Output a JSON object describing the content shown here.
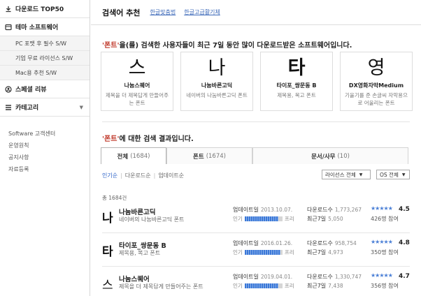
{
  "sidebar": {
    "items": [
      {
        "label": "다운로드 TOP50",
        "icon": "download-icon"
      },
      {
        "label": "테마 소프트웨어",
        "icon": "theme-icon"
      },
      {
        "label": "스페셜 리뷰",
        "icon": "review-icon"
      },
      {
        "label": "카테고리",
        "icon": "category-icon"
      }
    ],
    "subitems": [
      "PC 포맷 후 필수 S/W",
      "기업 무료 라이선스 S/W",
      "Mac용 추천 S/W"
    ],
    "links": [
      "Software 고객센터",
      "운영원칙",
      "공지사항",
      "자료등록"
    ]
  },
  "header": {
    "title": "검색어 추천",
    "keywords": [
      "한글맞춤법",
      "한글고급활기체"
    ]
  },
  "recommend": {
    "query": "'폰트'",
    "rest": "을(를) 검색한 사용자들이 최근 7일 동안 많이 다운로드받은 소프트웨어입니다.",
    "cards": [
      {
        "glyph": "스",
        "name": "나눔스퀘어",
        "desc": "제목을 더 제목답게 만들어주는 폰트"
      },
      {
        "glyph": "나",
        "name": "나눔바른고딕",
        "desc": "네이버의 나눔바른고딕 폰트"
      },
      {
        "glyph": "타",
        "name": "타이포_쌍문동 B",
        "desc": "제목용, 복고 폰트"
      },
      {
        "glyph": "영",
        "name": "DX영화자막Medium",
        "desc": "기울기를 준 손글씨 자막용으로 어울리는 폰트"
      }
    ]
  },
  "results": {
    "query": "'폰트'",
    "rest": "에 대한 검색 결과입니다.",
    "tabs": [
      {
        "label": "전체",
        "count": "(1684)"
      },
      {
        "label": "폰트",
        "count": "(1674)"
      },
      {
        "label": "문서/사무",
        "count": "(10)"
      }
    ],
    "sorts": [
      "인기순",
      "다운로드순",
      "업데이트순"
    ],
    "license_select": "라이선스 전체",
    "os_select": "OS 전체",
    "total": "총 1684건",
    "labels": {
      "update": "업데이트일",
      "popularity": "인기",
      "free": "프리",
      "downloads": "다운로드수",
      "weekly": "최근7일"
    },
    "rows": [
      {
        "glyph": "나",
        "name": "나눔바른고딕",
        "desc": "네이버의 나눔바른고딕 폰트",
        "update": "2013.10.07.",
        "downloads": "1,773,267",
        "weekly": "5,050",
        "stars": "★★★★★",
        "score": "4.5",
        "participants": "426명 참여",
        "popularity": 0.9
      },
      {
        "glyph": "타",
        "name": "타이포_쌍문동 B",
        "desc": "제목용, 복고 폰트",
        "update": "2016.01.26.",
        "downloads": "958,754",
        "weekly": "4,973",
        "stars": "★★★★★",
        "score": "4.8",
        "participants": "350명 참여",
        "popularity": 0.95
      },
      {
        "glyph": "스",
        "name": "나눔스퀘어",
        "desc": "제목을 더 제목답게 만들어주는 폰트",
        "update": "2019.04.01.",
        "downloads": "1,330,747",
        "weekly": "7,438",
        "stars": "★★★★★",
        "score": "4.7",
        "participants": "356명 참여",
        "popularity": 0.9
      }
    ]
  }
}
